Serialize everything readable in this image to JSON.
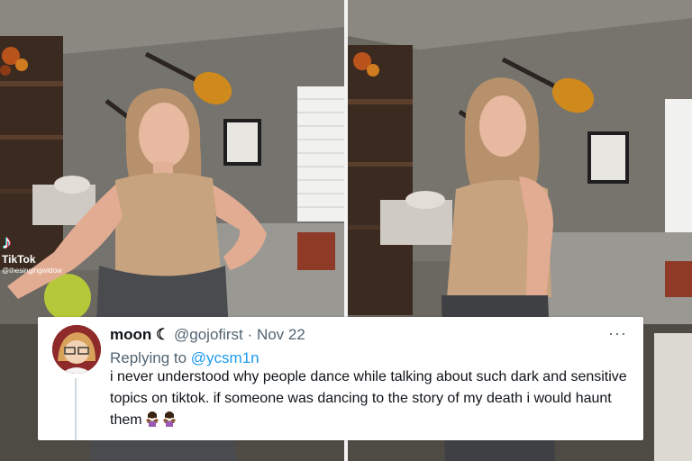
{
  "video": {
    "watermark_brand": "TikTok",
    "watermark_handle": "@thesingingwidow"
  },
  "tweet": {
    "display_name": "moon",
    "moon_glyph": "☾",
    "handle": "@gojofirst",
    "separator": "·",
    "date": "Nov 22",
    "replying_prefix": "Replying to ",
    "replying_to": "@ycsm1n",
    "body": "i never understood why people dance while talking about such dark and sensitive topics on tiktok. if someone was dancing to the story of my death i would haunt them",
    "emojis": [
      "woman-shrugging-icon",
      "woman-shrugging-icon"
    ],
    "more_label": "···"
  },
  "colors": {
    "link": "#1d9bf0",
    "text": "#0f1419",
    "muted": "#536471"
  }
}
